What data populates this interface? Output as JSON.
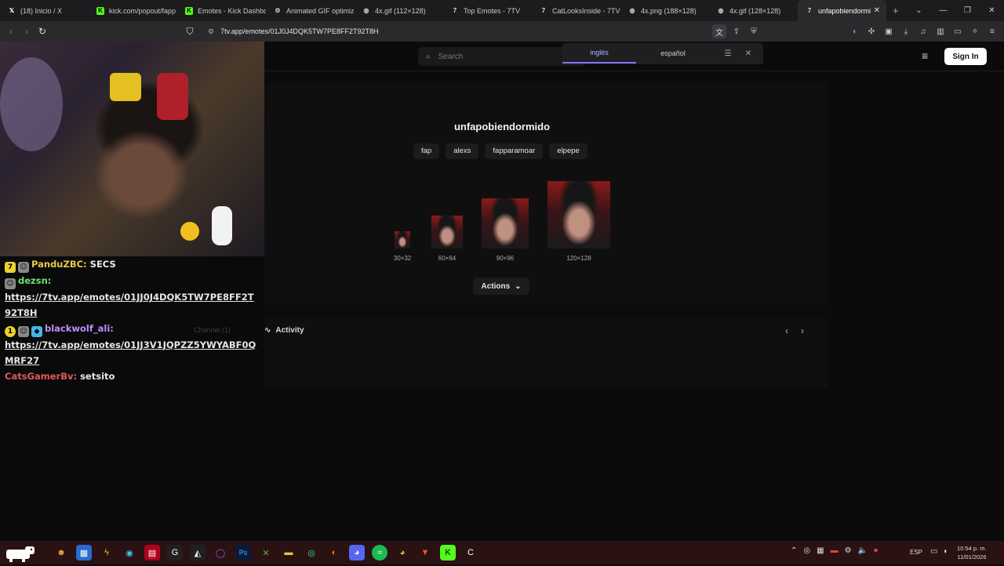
{
  "browser": {
    "tabs": [
      {
        "title": "(18) Inicio / X",
        "icon": "x-icon",
        "color": "#1c1c1e"
      },
      {
        "title": "kick.com/popout/fapp",
        "icon": "kick-icon",
        "color": "#53fc18"
      },
      {
        "title": "Emotes - Kick Dashbo",
        "icon": "kick-icon",
        "color": "#53fc18"
      },
      {
        "title": "Animated GIF optimiz",
        "icon": "ezgif-icon",
        "color": "#cccccc"
      },
      {
        "title": "4x.gif (112×128)",
        "icon": "globe-icon",
        "color": "#cccccc"
      },
      {
        "title": "Top Emotes - 7TV",
        "icon": "7tv-icon",
        "color": "#cccccc"
      },
      {
        "title": "CatLooksInside - 7TV",
        "icon": "7tv-icon",
        "color": "#cccccc"
      },
      {
        "title": "4x.png (188×128)",
        "icon": "globe-icon",
        "color": "#cccccc"
      },
      {
        "title": "4x.gif (128×128)",
        "icon": "globe-icon",
        "color": "#cccccc"
      },
      {
        "title": "unfapobiendormi",
        "icon": "7tv-icon",
        "color": "#cccccc",
        "active": true
      }
    ],
    "new_tab": "+",
    "url": "7tv.app/emotes/01J0J4DQK5TW7PE8FF2T92T8H"
  },
  "site": {
    "search_placeholder": "Search",
    "sign_in": "Sign In",
    "translate": {
      "lang_a": "inglés",
      "lang_b": "español"
    },
    "emote": {
      "name": "unfapobiendormido",
      "tags": [
        "fap",
        "alexs",
        "fapparamoar",
        "elpepe"
      ],
      "sizes": [
        "30×32",
        "60×64",
        "90×96",
        "120×128"
      ],
      "actions": "Actions"
    },
    "activity": "Activity",
    "channel_ghost": "Channel (1)"
  },
  "chat": {
    "messages": [
      {
        "user": "PanduZBC:",
        "text": "SECS",
        "user_color": "#e9c84a"
      },
      {
        "user": "dezsn:",
        "link": "https://7tv.app/emotes/01JJ0J4DQK5TW7PE8FF2T92T8H",
        "user_color": "#6ee06e"
      },
      {
        "user": "blackwolf_ali:",
        "link": "https://7tv.app/emotes/01JJ3V1JQPZZ5YWYABF0QMRF27",
        "user_color": "#c08cff"
      },
      {
        "user": "CatsGamerBv:",
        "text": "setsito",
        "user_color": "#e05a5a"
      }
    ]
  },
  "taskbar": {
    "lang": "ESP",
    "time": "10:54 p. m.",
    "date": "11/01/2026"
  }
}
